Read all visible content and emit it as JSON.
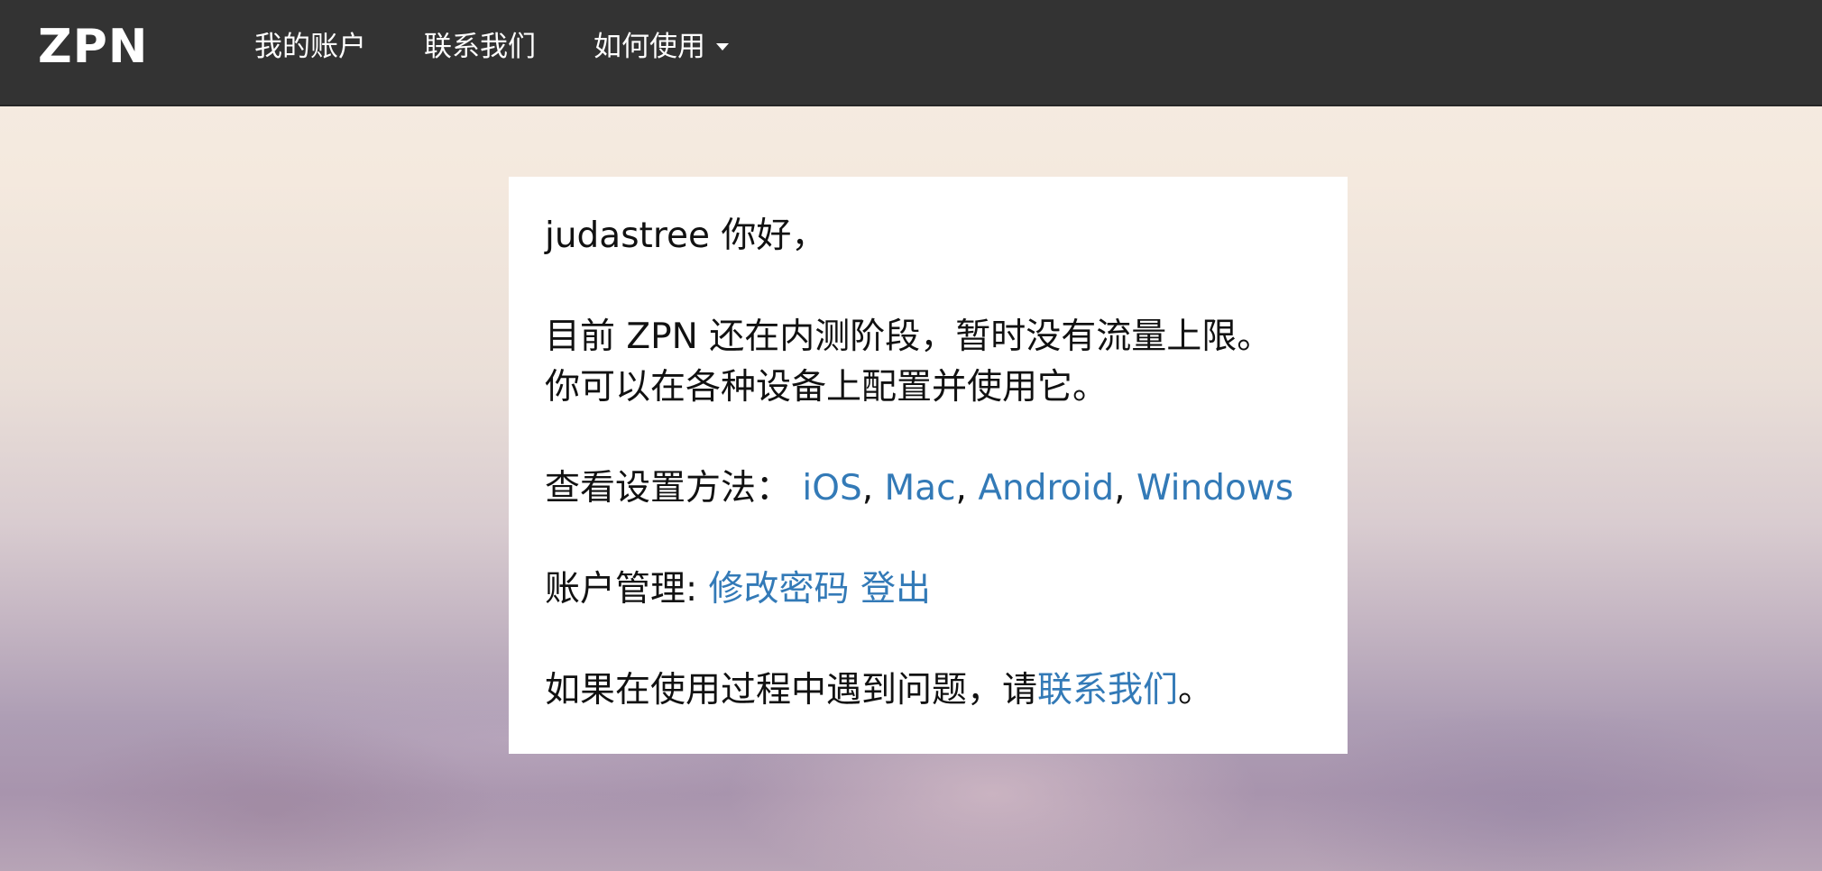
{
  "navbar": {
    "brand": "ZPN",
    "items": [
      {
        "label": "我的账户"
      },
      {
        "label": "联系我们"
      },
      {
        "label": "如何使用"
      }
    ]
  },
  "card": {
    "greeting": "judastree 你好，",
    "notice_line1": "目前 ZPN 还在内测阶段，暂时没有流量上限。",
    "notice_line2": "你可以在各种设备上配置并使用它。",
    "setup_label": "查看设置方法：",
    "setup_links": [
      "iOS",
      "Mac",
      "Android",
      "Windows"
    ],
    "setup_separator": ",",
    "account_label": "账户管理: ",
    "change_password": "修改密码",
    "logout": "登出",
    "help_prefix": "如果在使用过程中遇到问题，请",
    "help_link": "联系我们",
    "help_suffix": "。"
  },
  "colors": {
    "navbar_bg": "#333333",
    "link": "#337ab7",
    "text": "#111111"
  }
}
